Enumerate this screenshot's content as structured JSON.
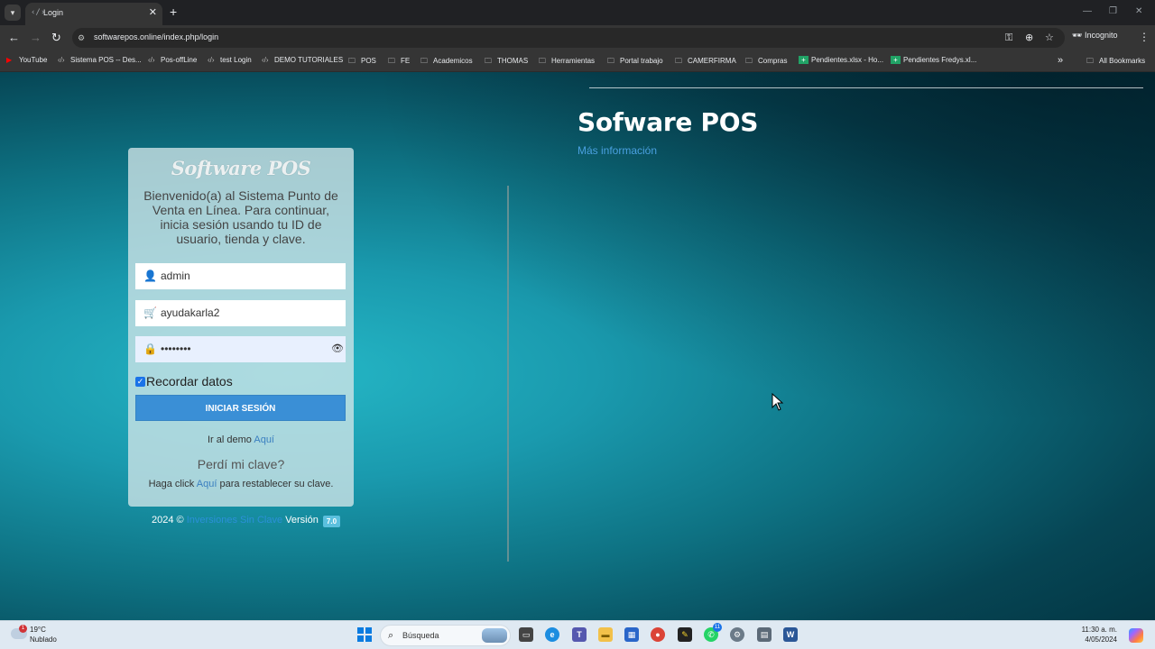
{
  "browser": {
    "tab_title": "Login",
    "url": "softwarepos.online/index.php/login",
    "incognito_label": "Incognito",
    "bookmarks": [
      {
        "label": "YouTube",
        "icon": "youtube-icon"
      },
      {
        "label": "Sistema POS -- Des...",
        "icon": "code-icon"
      },
      {
        "label": "Pos-offLine",
        "icon": "code-icon"
      },
      {
        "label": "test Login",
        "icon": "code-icon"
      },
      {
        "label": "DEMO TUTORIALES",
        "icon": "code-icon"
      },
      {
        "label": "POS",
        "icon": "folder-icon"
      },
      {
        "label": "FE",
        "icon": "folder-icon"
      },
      {
        "label": "Academicos",
        "icon": "folder-icon"
      },
      {
        "label": "THOMAS",
        "icon": "folder-icon"
      },
      {
        "label": "Herramientas",
        "icon": "folder-icon"
      },
      {
        "label": "Portal trabajo",
        "icon": "folder-icon"
      },
      {
        "label": "CAMERFIRMA",
        "icon": "folder-icon"
      },
      {
        "label": "Compras",
        "icon": "folder-icon"
      },
      {
        "label": "Pendientes.xlsx - Ho...",
        "icon": "sheets-icon"
      },
      {
        "label": "Pendientes Fredys.xl...",
        "icon": "sheets-icon"
      }
    ],
    "all_bookmarks_label": "All Bookmarks"
  },
  "hero": {
    "title": "Sofware POS",
    "more_info": "Más información"
  },
  "login": {
    "logo_text": "Software POS",
    "welcome": "Bienvenido(a) al Sistema Punto de Venta en Línea. Para continuar, inicia sesión usando tu ID de usuario, tienda y clave.",
    "user_value": "admin",
    "store_value": "ayudakarla2",
    "password_mask": "••••••••",
    "remember_label": "Recordar datos",
    "remember_checked": true,
    "submit_label": "INICIAR SESIÓN",
    "demo_prefix": "Ir al demo ",
    "demo_link": "Aquí",
    "forgot_title": "Perdí mi clave?",
    "reset_prefix": "Haga click ",
    "reset_link": "Aquí",
    "reset_suffix": " para restablecer su clave."
  },
  "footer": {
    "copyright": "2024 ©",
    "brand": "Inversiones Sin Clave",
    "version_label": "Versión",
    "version": "7.0"
  },
  "taskbar": {
    "weather_temp": "19°C",
    "weather_desc": "Nublado",
    "weather_badge": "1",
    "search_label": "Búsqueda",
    "whatsapp_badge": "11",
    "time": "11:30 a. m.",
    "date": "4/05/2024"
  },
  "colors": {
    "accent_button": "#3a8fd6",
    "link": "#4aa0e0",
    "version_badge": "#5bc0de"
  }
}
